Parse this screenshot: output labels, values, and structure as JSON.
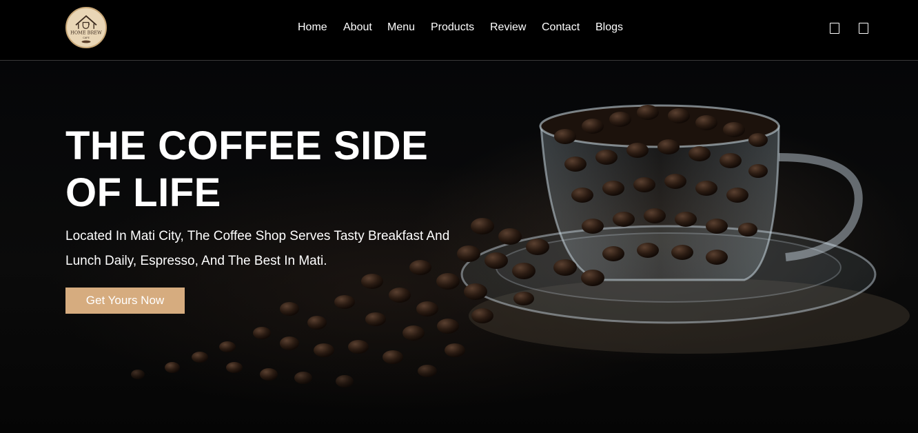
{
  "brand": {
    "logo_icon": "home-brew-cafe-logo",
    "logo_text": "HOME BREW",
    "logo_subtext": "CAFE"
  },
  "nav": {
    "items": [
      "Home",
      "About",
      "Menu",
      "Products",
      "Review",
      "Contact",
      "Blogs"
    ]
  },
  "header_icons": {
    "search": "search-icon",
    "cart": "cart-icon"
  },
  "hero": {
    "title": "THE COFFEE SIDE OF LIFE",
    "description": "Located In Mati City, The Coffee Shop Serves Tasty Breakfast And Lunch Daily, Espresso, And The Best In Mati.",
    "cta_label": "Get Yours Now",
    "image": "coffee-beans-in-glass-cup-image"
  },
  "colors": {
    "background": "#000000",
    "accent": "#d6ac7f",
    "text": "#ffffff"
  }
}
